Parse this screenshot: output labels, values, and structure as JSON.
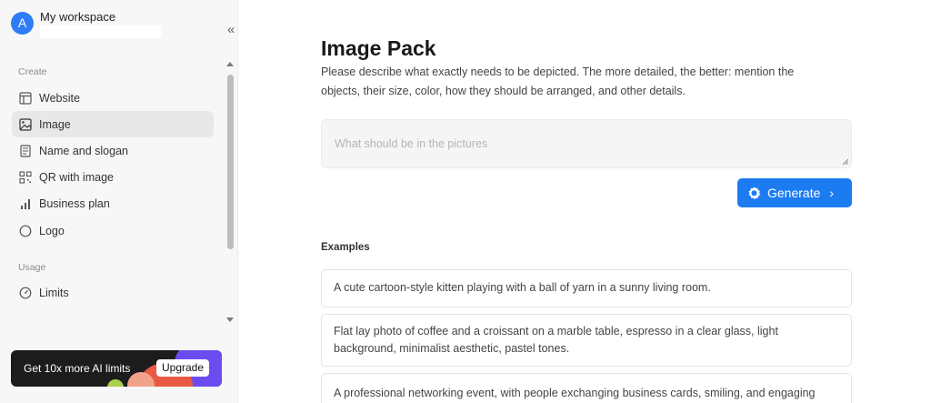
{
  "workspace": {
    "avatar_letter": "A",
    "name": "My workspace",
    "collapse_icon": "«"
  },
  "sidebar": {
    "create_label": "Create",
    "usage_label": "Usage",
    "items": [
      {
        "label": "Website",
        "icon": "layout-icon"
      },
      {
        "label": "Image",
        "icon": "image-icon",
        "active": true
      },
      {
        "label": "Name and slogan",
        "icon": "document-icon"
      },
      {
        "label": "QR with image",
        "icon": "qr-icon"
      },
      {
        "label": "Business plan",
        "icon": "bar-chart-icon"
      },
      {
        "label": "Logo",
        "icon": "circle-icon"
      }
    ],
    "usage_items": [
      {
        "label": "Limits",
        "icon": "gauge-icon"
      }
    ]
  },
  "promo": {
    "text": "Get 10x more AI limits",
    "button": "Upgrade"
  },
  "main": {
    "title": "Image Pack",
    "description": "Please describe what exactly needs to be depicted. The more detailed, the better: mention the objects, their size, color, how they should be arranged, and other details.",
    "prompt_placeholder": "What should be in the pictures",
    "generate_label": "Generate",
    "examples_label": "Examples",
    "examples": [
      "A cute cartoon-style kitten playing with a ball of yarn in a sunny living room.",
      "Flat lay photo of coffee and a croissant on a marble table, espresso in a clear glass, light background, minimalist aesthetic, pastel tones.",
      "A professional networking event, with people exchanging business cards, smiling, and engaging"
    ]
  },
  "colors": {
    "accent": "#1d7bf2",
    "avatar": "#2f7cf6",
    "sidebar_bg": "#f7f7f7",
    "active_item_bg": "#e8e8e8"
  }
}
